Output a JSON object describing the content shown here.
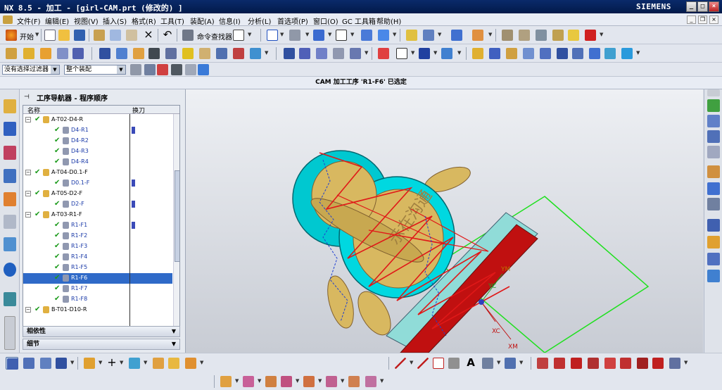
{
  "window": {
    "title": "NX 8.5 - 加工 - [girl-CAM.prt  (修改的) ]",
    "brand": "SIEMENS"
  },
  "menu": [
    "文件(F)",
    "编辑(E)",
    "视图(V)",
    "插入(S)",
    "格式(R)",
    "工具(T)",
    "装配(A)",
    "信息(I)",
    "分析(L)",
    "首选项(P)",
    "窗口(O)",
    "GC 工具箱",
    "帮助(H)"
  ],
  "toolbar": {
    "start_label": "开始",
    "command_finder_label": "命令查找器"
  },
  "filters": {
    "selection_filter": "没有选择过滤器",
    "assembly_scope": "整个装配"
  },
  "status": {
    "message": "CAM 加工工序 'R1-F6' 已选定"
  },
  "navigator": {
    "title": "工序导航器 - 程序顺序",
    "col_name": "名称",
    "col_tool_change": "换刀",
    "rows": [
      {
        "label": "A-T02-D4-R",
        "level": 0,
        "type": "group",
        "tool_change": false
      },
      {
        "label": "D4-R1",
        "level": 1,
        "type": "op",
        "tool_change": true
      },
      {
        "label": "D4-R2",
        "level": 1,
        "type": "op",
        "tool_change": false
      },
      {
        "label": "D4-R3",
        "level": 1,
        "type": "op",
        "tool_change": false
      },
      {
        "label": "D4-R4",
        "level": 1,
        "type": "op",
        "tool_change": false
      },
      {
        "label": "A-T04-D0.1-F",
        "level": 0,
        "type": "group",
        "tool_change": false
      },
      {
        "label": "D0.1-F",
        "level": 1,
        "type": "op",
        "tool_change": true
      },
      {
        "label": "A-T05-D2-F",
        "level": 0,
        "type": "group",
        "tool_change": false
      },
      {
        "label": "D2-F",
        "level": 1,
        "type": "op",
        "tool_change": true
      },
      {
        "label": "A-T03-R1-F",
        "level": 0,
        "type": "group",
        "tool_change": false
      },
      {
        "label": "R1-F1",
        "level": 1,
        "type": "op",
        "tool_change": true
      },
      {
        "label": "R1-F2",
        "level": 1,
        "type": "op",
        "tool_change": false
      },
      {
        "label": "R1-F3",
        "level": 1,
        "type": "op",
        "tool_change": false
      },
      {
        "label": "R1-F4",
        "level": 1,
        "type": "op",
        "tool_change": false
      },
      {
        "label": "R1-F5",
        "level": 1,
        "type": "op",
        "tool_change": false
      },
      {
        "label": "R1-F6",
        "level": 1,
        "type": "op",
        "tool_change": false,
        "selected": true
      },
      {
        "label": "R1-F7",
        "level": 1,
        "type": "op",
        "tool_change": false
      },
      {
        "label": "R1-F8",
        "level": 1,
        "type": "op",
        "tool_change": false
      },
      {
        "label": "B-T01-D10-R",
        "level": 0,
        "type": "group",
        "tool_change": false
      }
    ],
    "section_dependency": "相依性",
    "section_details": "细节"
  },
  "viewport": {
    "axis_ym": "YM",
    "axis_yc": "YC",
    "axis_xc": "XC",
    "axis_xm": "XM",
    "engraving": "示在沟通",
    "colors": {
      "part": "#d8b860",
      "stock": "#00d8e0",
      "base": "#c01010",
      "toolpath": "#e01818",
      "boundary": "#20e020"
    }
  }
}
